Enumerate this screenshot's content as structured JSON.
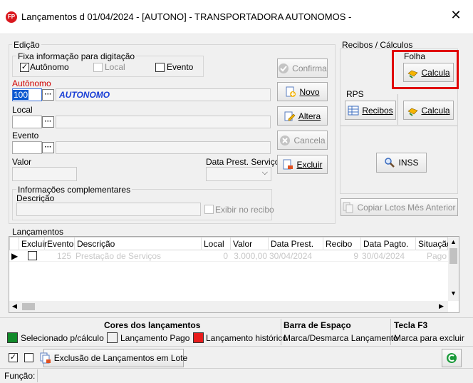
{
  "window": {
    "title": "Lançamentos d 01/04/2024 - [AUTONO] - TRANSPORTADORA AUTONOMOS -",
    "app_icon_label": "FP",
    "close_glyph": "✕"
  },
  "edicao": {
    "title": "Edição",
    "fixa_title": "Fixa informação para digitação",
    "fixa_options": [
      {
        "label": "Autônomo",
        "checked": true
      },
      {
        "label": "Local",
        "checked": false
      },
      {
        "label": "Evento",
        "checked": false
      }
    ],
    "autonomo_label": "Autônomo",
    "autonomo_code": "100",
    "autonomo_name": "AUTONOMO",
    "local_label": "Local",
    "evento_label": "Evento",
    "valor_label": "Valor",
    "data_prest_label": "Data Prest. Serviço",
    "info_comp_title": "Informações complementares",
    "descricao_label": "Descrição",
    "exibir_label": "Exibir no recibo",
    "lookup_glyph": "···"
  },
  "action_buttons": {
    "confirma": "Confirma",
    "novo": "Novo",
    "altera": "Altera",
    "cancela": "Cancela",
    "excluir": "Excluir"
  },
  "recibos": {
    "title": "Recibos / Cálculos",
    "folha_title": "Folha",
    "folha_calcula": "Calcula",
    "rps_title": "RPS",
    "rps_recibos": "Recibos",
    "rps_calcula": "Calcula",
    "inss": "INSS",
    "copiar": "Copiar Lctos Mês Anterior"
  },
  "lancamentos": {
    "title": "Lançamentos",
    "columns": [
      "Excluir",
      "Evento",
      "Descrição",
      "Local",
      "Valor",
      "Data Prest.",
      "Recibo",
      "Data Pagto.",
      "Situação"
    ],
    "rows": [
      {
        "evento": "125",
        "descricao": "Prestação de Serviços",
        "local": "0",
        "valor": "3.000,00",
        "data_prest": "30/04/2024",
        "recibo": "9",
        "data_pagto": "30/04/2024",
        "situacao": "Pago"
      }
    ]
  },
  "legend": {
    "cores_title": "Cores dos lançamentos",
    "items": [
      {
        "label": "Selecionado p/cálculo",
        "color": "#118a2a"
      },
      {
        "label": "Lançamento Pago",
        "color": "#f0f0f0"
      },
      {
        "label": "Lançamento histórico",
        "color": "#e81c1c"
      }
    ],
    "barra_title": "Barra de Espaço",
    "barra_desc": "Marca/Desmarca Lançamento",
    "tecla_title": "Tecla F3",
    "tecla_desc": "Marca para excluir"
  },
  "bottom": {
    "exclusao": "Exclusão de Lançamentos em Lote",
    "funcao_label": "Função:"
  },
  "colors": {
    "highlight": "#e00000",
    "autonomo_label": "#d00000",
    "autonomo_name": "#1a3fd6"
  }
}
